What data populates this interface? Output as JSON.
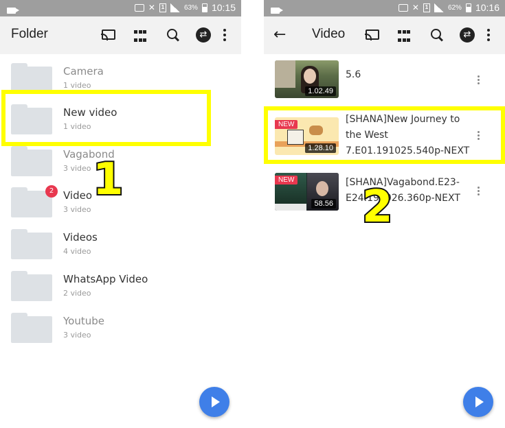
{
  "left": {
    "status": {
      "battery": "63%",
      "time": "10:15",
      "sim": "1"
    },
    "appbar": {
      "title": "Folder"
    },
    "folders": [
      {
        "name": "Camera",
        "count": "1 video"
      },
      {
        "name": "New video",
        "count": "1 video"
      },
      {
        "name": "Vagabond",
        "count": "3 video"
      },
      {
        "name": "Video",
        "count": "3 video",
        "badge": "2"
      },
      {
        "name": "Videos",
        "count": "4 video"
      },
      {
        "name": "WhatsApp Video",
        "count": "2 video"
      },
      {
        "name": "Youtube",
        "count": "3 video"
      }
    ],
    "step_label": "1"
  },
  "right": {
    "status": {
      "battery": "62%",
      "time": "10:16",
      "sim": "1"
    },
    "appbar": {
      "title": "Video"
    },
    "videos": [
      {
        "title": "5.6",
        "duration": "1.02.49"
      },
      {
        "title": "[SHANA]New Journey to the West 7.E01.191025.540p-NEXT",
        "duration": "1.28.10",
        "badge": "NEW"
      },
      {
        "title": "[SHANA]Vagabond.E23-E24.191026.360p-NEXT",
        "duration": "58.56",
        "badge": "NEW"
      }
    ],
    "step_label": "2"
  },
  "colors": {
    "highlight": "#ffff00",
    "fab": "#3f7fe8",
    "badge": "#e8384f"
  },
  "icons": [
    "cast-icon",
    "grid-icon",
    "search-icon",
    "sync-icon",
    "more-icon",
    "back-icon",
    "play-icon",
    "folder-icon"
  ]
}
